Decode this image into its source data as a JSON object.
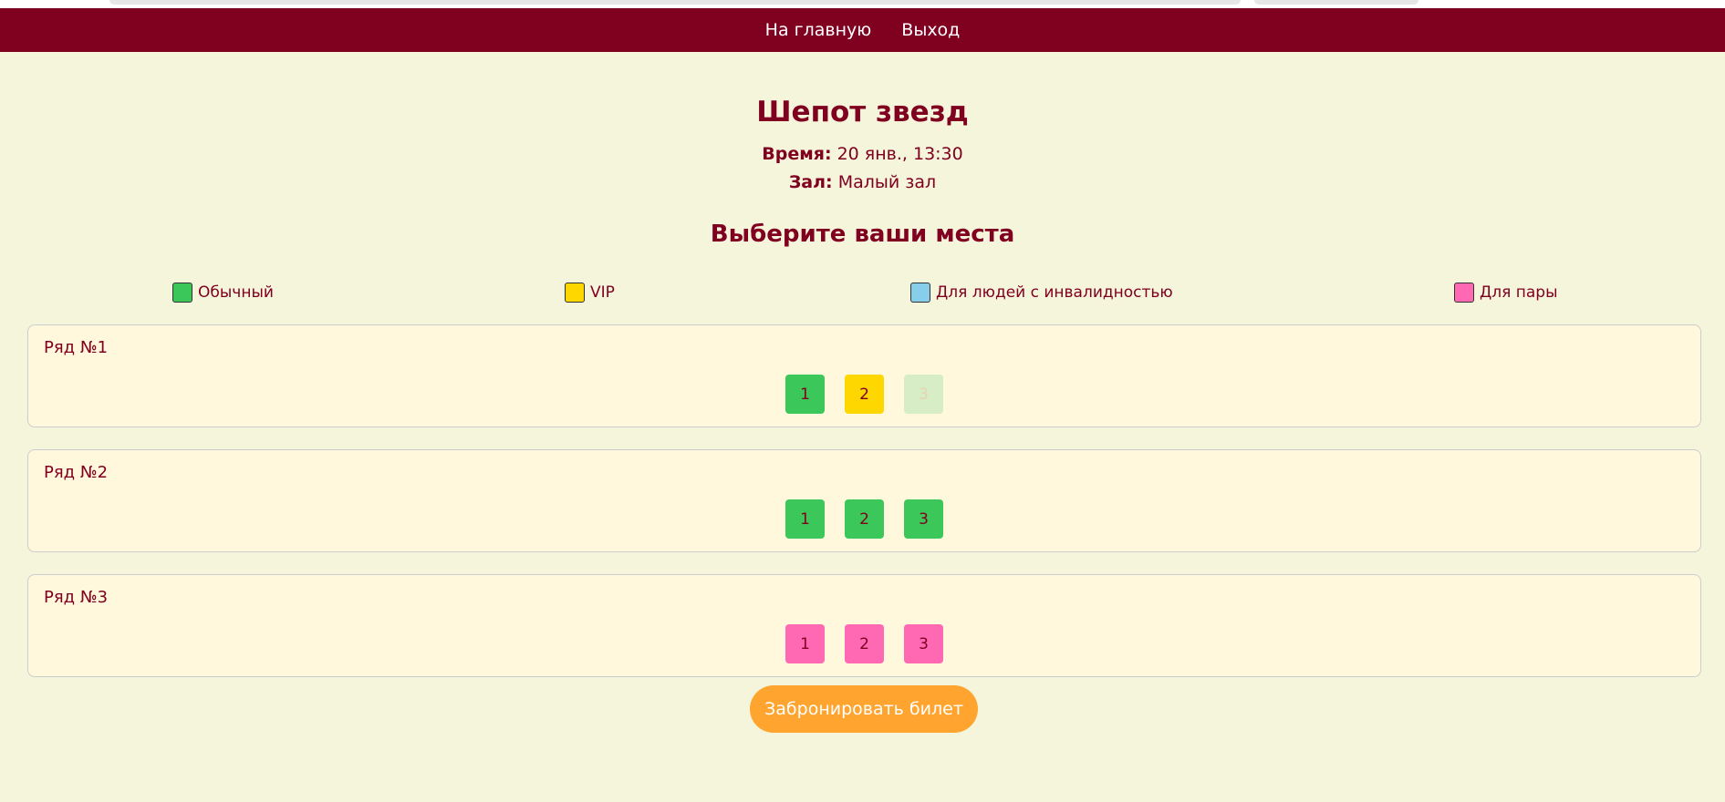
{
  "nav": {
    "home": "На главную",
    "logout": "Выход"
  },
  "movie": {
    "title": "Шепот звезд",
    "time_label": "Время:",
    "time_value": "20 янв., 13:30",
    "hall_label": "Зал:",
    "hall_value": "Малый зал"
  },
  "subtitle": "Выберите ваши места",
  "legend": [
    {
      "label": "Обычный",
      "color": "#3cc75a"
    },
    {
      "label": "VIP",
      "color": "#ffd700"
    },
    {
      "label": "Для людей с инвалидностью",
      "color": "#87ceeb"
    },
    {
      "label": "Для пары",
      "color": "#ff69b4"
    }
  ],
  "rows": [
    {
      "label": "Ряд №1",
      "seats": [
        {
          "number": "1",
          "type": "regular"
        },
        {
          "number": "2",
          "type": "vip"
        },
        {
          "number": "3",
          "type": "taken"
        }
      ]
    },
    {
      "label": "Ряд №2",
      "seats": [
        {
          "number": "1",
          "type": "regular"
        },
        {
          "number": "2",
          "type": "regular"
        },
        {
          "number": "3",
          "type": "regular"
        }
      ]
    },
    {
      "label": "Ряд №3",
      "seats": [
        {
          "number": "1",
          "type": "couple"
        },
        {
          "number": "2",
          "type": "couple"
        },
        {
          "number": "3",
          "type": "couple"
        }
      ]
    }
  ],
  "book_button": "Забронировать билет",
  "colors": {
    "brand": "#800020",
    "background": "#f5f5dc",
    "card": "#fff8dc",
    "accent": "#ffa42e"
  }
}
